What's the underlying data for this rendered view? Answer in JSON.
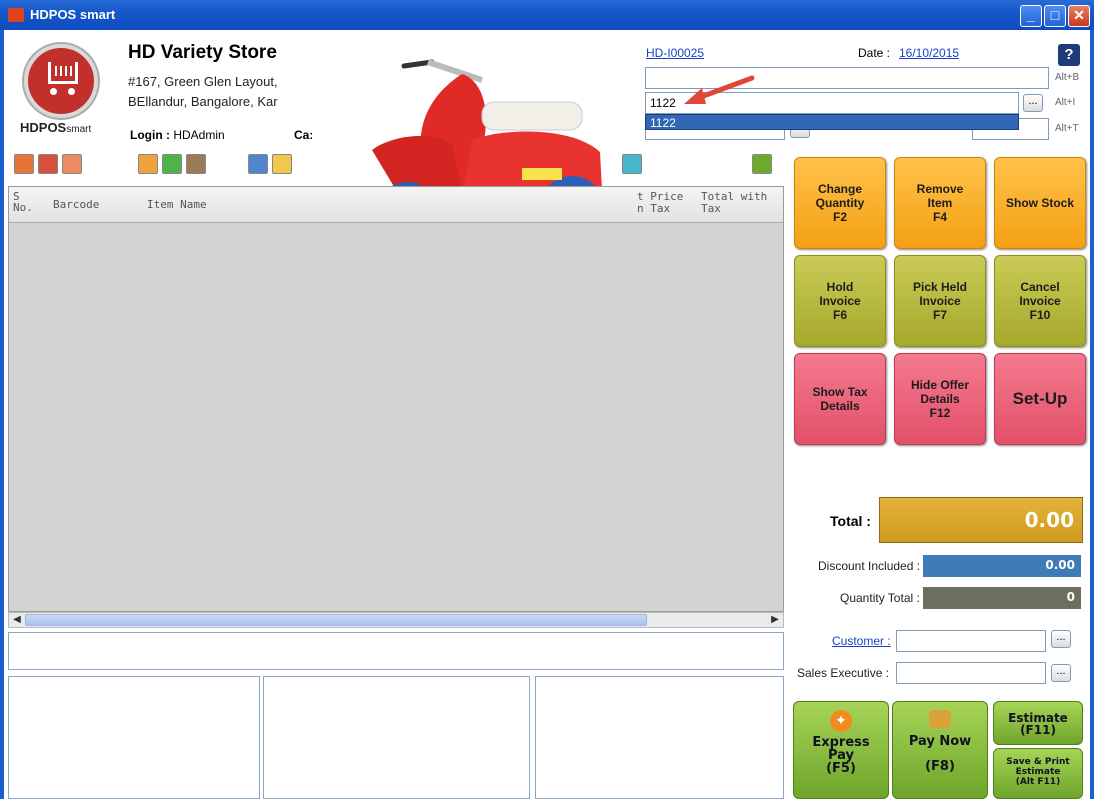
{
  "window": {
    "title": "HDPOS smart",
    "min": "_",
    "max": "□",
    "close": "✕"
  },
  "store": {
    "name": "HD Variety Store",
    "addr1": "#167, Green Glen Layout,",
    "addr2": "BEllandur, Bangalore, Kar",
    "logo_main": "HDPOS",
    "logo_sub": "smart"
  },
  "session": {
    "login_label": "Login :",
    "login_value": "HDAdmin",
    "cashier_label": "Ca:"
  },
  "invoice": {
    "number": "HD-I00025",
    "date_label": "Date :",
    "date": "16/10/2015"
  },
  "fields": {
    "barcode_alt": "Alt+B",
    "item_value": "1122",
    "item_alt": "Alt+I",
    "dropdown_option": "1122",
    "tx_alt": "Alt+T",
    "dots": "..."
  },
  "grid": {
    "headers": [
      "S No.",
      "Barcode",
      "Item Name",
      "t Price\nn Tax",
      "Total with\nTax"
    ]
  },
  "actions": [
    {
      "label": "Change\nQuantity\nF2",
      "color": "orange"
    },
    {
      "label": "Remove\nItem\nF4",
      "color": "orange"
    },
    {
      "label": "Show Stock",
      "color": "orange"
    },
    {
      "label": "Hold\nInvoice\nF6",
      "color": "olive"
    },
    {
      "label": "Pick Held\nInvoice\nF7",
      "color": "olive"
    },
    {
      "label": "Cancel\nInvoice\nF10",
      "color": "olive"
    },
    {
      "label": "Show Tax\nDetails",
      "color": "red"
    },
    {
      "label": "Hide Offer\nDetails\nF12",
      "color": "red"
    },
    {
      "label": "Set-Up",
      "color": "red"
    }
  ],
  "totals": {
    "total_label": "Total :",
    "total": "0.00",
    "discount_label": "Discount Included :",
    "discount": "0.00",
    "qty_label": "Quantity Total :",
    "qty": "0"
  },
  "customer": {
    "label": "Customer :",
    "exec_label": "Sales Executive :"
  },
  "pay": {
    "express": "Express\nPay\n(F5)",
    "paynow": "Pay Now",
    "paynow_key": "(F8)",
    "estimate": "Estimate\n(F11)",
    "save_print": "Save & Print\nEstimate\n(Alt F11)"
  },
  "colors": {
    "title": "#1557c9",
    "total": "#d9a62b",
    "discount": "#3f7bb6",
    "qty": "#6e6e5e"
  }
}
